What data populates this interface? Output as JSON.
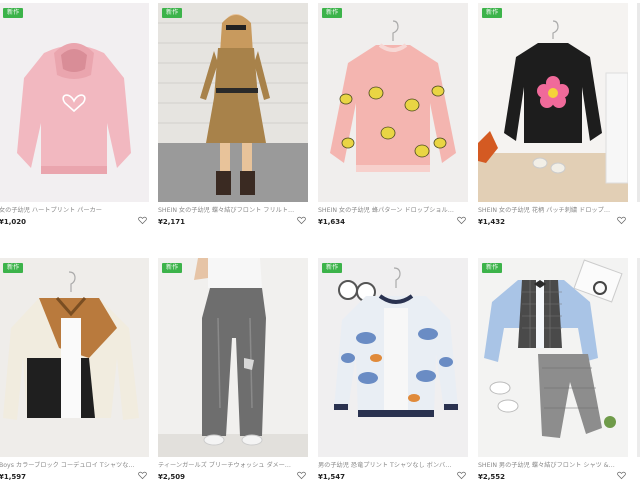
{
  "products": [
    {
      "badge": "新作",
      "title": "女の子幼児 ハートプリント パーカー",
      "price": "¥1,020",
      "photo": "pink-hoodie"
    },
    {
      "badge": "新作",
      "title": "SHEIN 女の子幼児 蝶々結びフロント フリルトリム ワ...",
      "price": "¥2,171",
      "photo": "girl-brown-dress"
    },
    {
      "badge": "新作",
      "title": "SHEIN 女の子幼児 蜂パターン ドロップショルダー セ...",
      "price": "¥1,634",
      "photo": "bee-sweater"
    },
    {
      "badge": "新作",
      "title": "SHEIN 女の子幼児 花柄 パッチ刺繍 ドロップショルダ...",
      "price": "¥1,432",
      "photo": "flower-sweater"
    },
    {
      "badge": "新作",
      "title": "Boys カラーブロック コーデュロイ Tシャツなし シャケ...",
      "price": "¥1,597",
      "photo": "colorblock-jacket"
    },
    {
      "badge": "新作",
      "title": "ティーンガールズ ブリーチウォッシュ ダメージストレー...",
      "price": "¥2,509",
      "photo": "grey-jeans"
    },
    {
      "badge": "新作",
      "title": "男の子幼児 恐竜プリント Tシャツなし ボンバージャケ...",
      "price": "¥1,547",
      "photo": "dino-jacket"
    },
    {
      "badge": "新作",
      "title": "SHEIN 男の子幼児 蝶々結びフロント シャツ & 格子柄...",
      "price": "¥2,552",
      "photo": "vest-set"
    }
  ],
  "colors": {
    "badge": "#3cb34a",
    "price": "#222222",
    "title": "#888888"
  },
  "icons": {
    "favorite": "heart-outline-icon"
  }
}
